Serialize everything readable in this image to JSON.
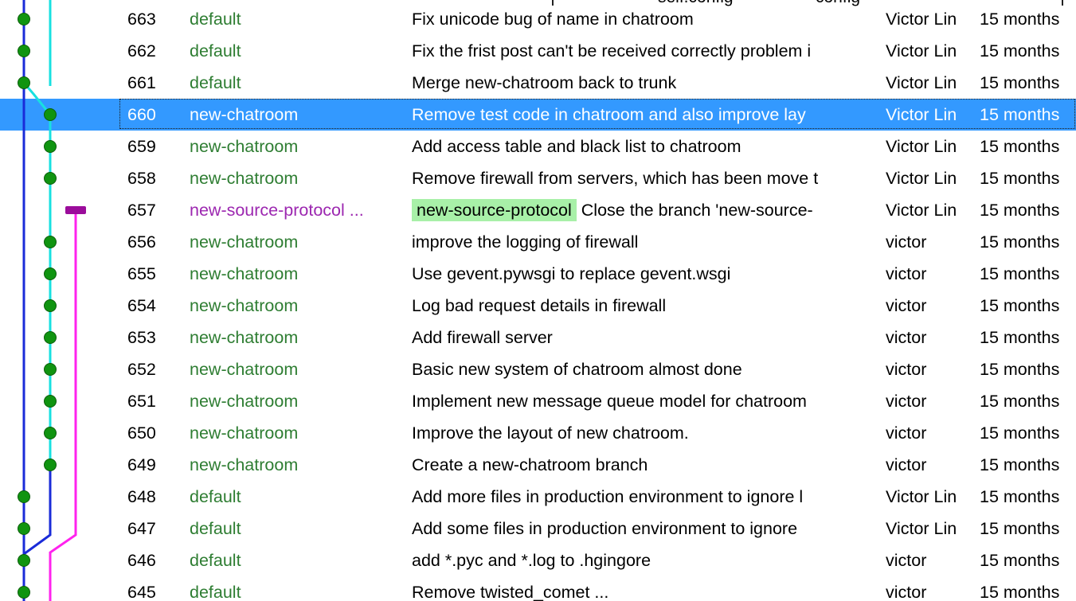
{
  "top_fragments": [
    "self.config",
    "config"
  ],
  "selected_rev": "660",
  "colors": {
    "selection": "#3399ff",
    "branch_default": "#2e7d32",
    "branch_other": "#9c27b0",
    "tag_background": "#a8f0a8",
    "graph_trunk": "#1a2bd8",
    "graph_chatroom": "#18e0e0",
    "graph_protocol": "#ff22ee",
    "graph_node": "#109410",
    "graph_closed_node": "#9b0c9b"
  },
  "rows": [
    {
      "rev": "663",
      "branch": "default",
      "description": "Fix unicode bug of name in chatroom",
      "author": "Victor Lin",
      "age": "15 months"
    },
    {
      "rev": "662",
      "branch": "default",
      "description": "Fix the frist post can't be received correctly problem i",
      "author": "Victor Lin",
      "age": "15 months"
    },
    {
      "rev": "661",
      "branch": "default",
      "description": "Merge new-chatroom back to trunk",
      "author": "Victor Lin",
      "age": "15 months"
    },
    {
      "rev": "660",
      "branch": "new-chatroom",
      "description": "Remove test code in chatroom and also improve lay",
      "author": "Victor Lin",
      "age": "15 months"
    },
    {
      "rev": "659",
      "branch": "new-chatroom",
      "description": "Add access table and black list to chatroom",
      "author": "Victor Lin",
      "age": "15 months"
    },
    {
      "rev": "658",
      "branch": "new-chatroom",
      "description": "Remove firewall from servers, which has been move t",
      "author": "Victor Lin",
      "age": "15 months"
    },
    {
      "rev": "657",
      "branch": "new-source-protocol ...",
      "tag": "new-source-protocol",
      "description": "Close the branch 'new-source-",
      "author": "Victor Lin",
      "age": "15 months"
    },
    {
      "rev": "656",
      "branch": "new-chatroom",
      "description": "improve the logging of firewall",
      "author": "victor",
      "age": "15 months"
    },
    {
      "rev": "655",
      "branch": "new-chatroom",
      "description": "Use gevent.pywsgi to replace gevent.wsgi",
      "author": "victor",
      "age": "15 months"
    },
    {
      "rev": "654",
      "branch": "new-chatroom",
      "description": "Log bad request details in firewall",
      "author": "victor",
      "age": "15 months"
    },
    {
      "rev": "653",
      "branch": "new-chatroom",
      "description": "Add firewall server",
      "author": "victor",
      "age": "15 months"
    },
    {
      "rev": "652",
      "branch": "new-chatroom",
      "description": "Basic new system of chatroom almost done",
      "author": "victor",
      "age": "15 months"
    },
    {
      "rev": "651",
      "branch": "new-chatroom",
      "description": "Implement new message queue model for chatroom",
      "author": "victor",
      "age": "15 months"
    },
    {
      "rev": "650",
      "branch": "new-chatroom",
      "description": "Improve the layout of new chatroom.",
      "author": "victor",
      "age": "15 months"
    },
    {
      "rev": "649",
      "branch": "new-chatroom",
      "description": "Create a new-chatroom branch",
      "author": "victor",
      "age": "15 months"
    },
    {
      "rev": "648",
      "branch": "default",
      "description": "Add more files in production environment to ignore l",
      "author": "Victor Lin",
      "age": "15 months"
    },
    {
      "rev": "647",
      "branch": "default",
      "description": "Add some files in production environment to ignore",
      "author": "Victor Lin",
      "age": "15 months"
    },
    {
      "rev": "646",
      "branch": "default",
      "description": "add *.pyc and *.log to .hgingore",
      "author": "victor",
      "age": "15 months"
    },
    {
      "rev": "645",
      "branch": "default",
      "description": "Remove twisted_comet ...",
      "author": "victor",
      "age": "15 months"
    }
  ]
}
